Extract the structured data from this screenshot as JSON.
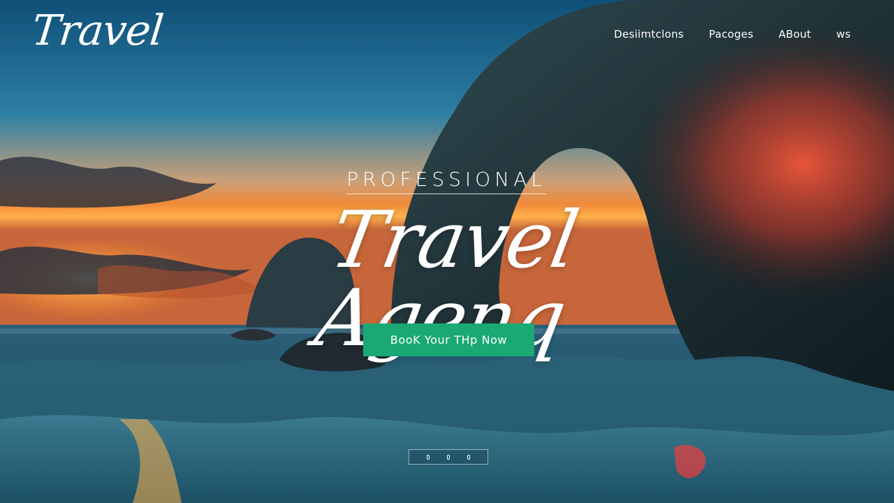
{
  "brand": {
    "logo_text": "Travel"
  },
  "nav": {
    "items": [
      "Desiimtclons",
      "Pacoges",
      "ABout",
      "ws"
    ]
  },
  "hero": {
    "kicker": "PROFESSIONAL",
    "headline": "Travel Agenq",
    "cta_label": "BooK Your THp Now"
  },
  "slider": {
    "count": 3,
    "active": 1
  },
  "colors": {
    "cta": "#1aa874",
    "text": "#ffffff"
  }
}
